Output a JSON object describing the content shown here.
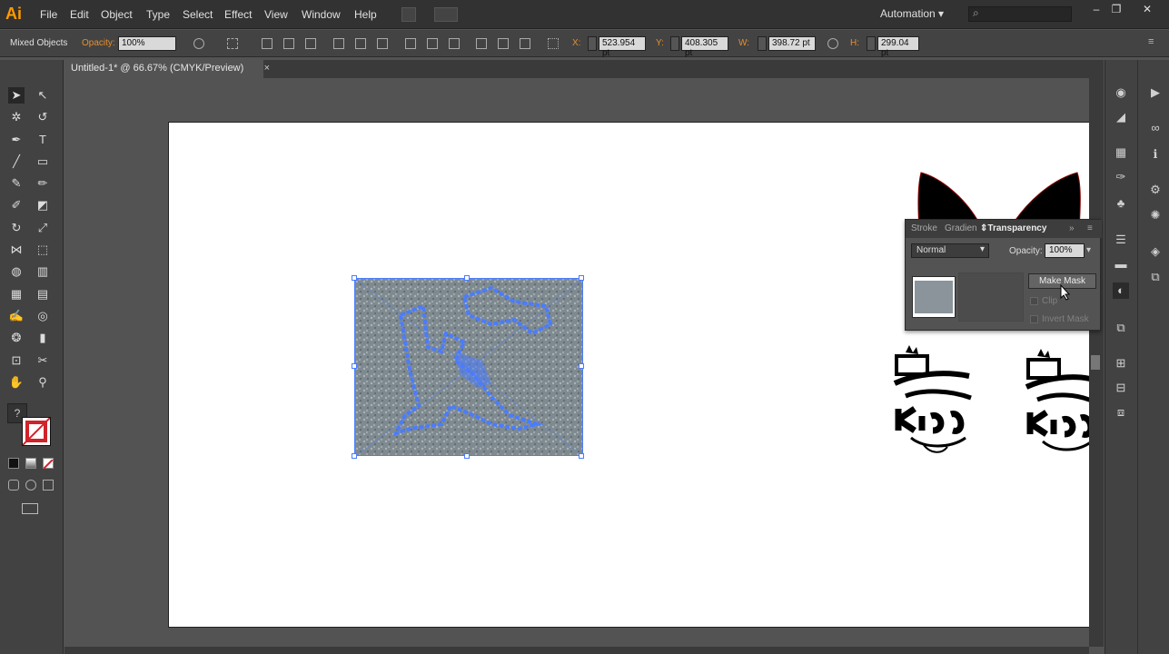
{
  "app": {
    "logo": "Ai",
    "menu": [
      "File",
      "Edit",
      "Object",
      "Type",
      "Select",
      "Effect",
      "View",
      "Window",
      "Help"
    ],
    "workspace": "Automation",
    "window_controls": [
      "–",
      "❐",
      "✕"
    ]
  },
  "control_bar": {
    "selection_type": "Mixed Objects",
    "opacity_label": "Opacity:",
    "opacity_value": "100%",
    "x_label": "X:",
    "x_value": "523.954 pt",
    "y_label": "Y:",
    "y_value": "408.305 pt",
    "w_label": "W:",
    "w_value": "398.72 pt",
    "h_label": "H:",
    "h_value": "299.04 pt"
  },
  "document_tab": {
    "title": "Untitled-1* @ 66.67% (CMYK/Preview)",
    "close": "×"
  },
  "tools": [
    "selection-tool",
    "direct-selection-tool",
    "magic-wand-tool",
    "lasso-tool",
    "pen-tool",
    "type-tool",
    "line-tool",
    "rectangle-tool",
    "paintbrush-tool",
    "pencil-tool",
    "blob-brush-tool",
    "eraser-tool",
    "rotate-tool",
    "scale-tool",
    "width-tool",
    "free-transform-tool",
    "shape-builder-tool",
    "perspective-grid-tool",
    "mesh-tool",
    "gradient-tool",
    "eyedropper-tool",
    "blend-tool",
    "symbol-sprayer-tool",
    "column-graph-tool",
    "artboard-tool",
    "slice-tool",
    "hand-tool",
    "zoom-tool"
  ],
  "transparency_panel": {
    "tabs": [
      "Stroke",
      "Gradien",
      "Transparency"
    ],
    "active_tab": "Transparency",
    "blend_mode": "Normal",
    "opacity_label": "Opacity:",
    "opacity_value": "100%",
    "make_mask": "Make Mask",
    "clip_label": "Clip",
    "invert_mask_label": "Invert Mask"
  },
  "colors": {
    "accent_orange": "#e88f2a",
    "selection_blue": "#4a7cff",
    "app_logo": "#ff9a00"
  }
}
